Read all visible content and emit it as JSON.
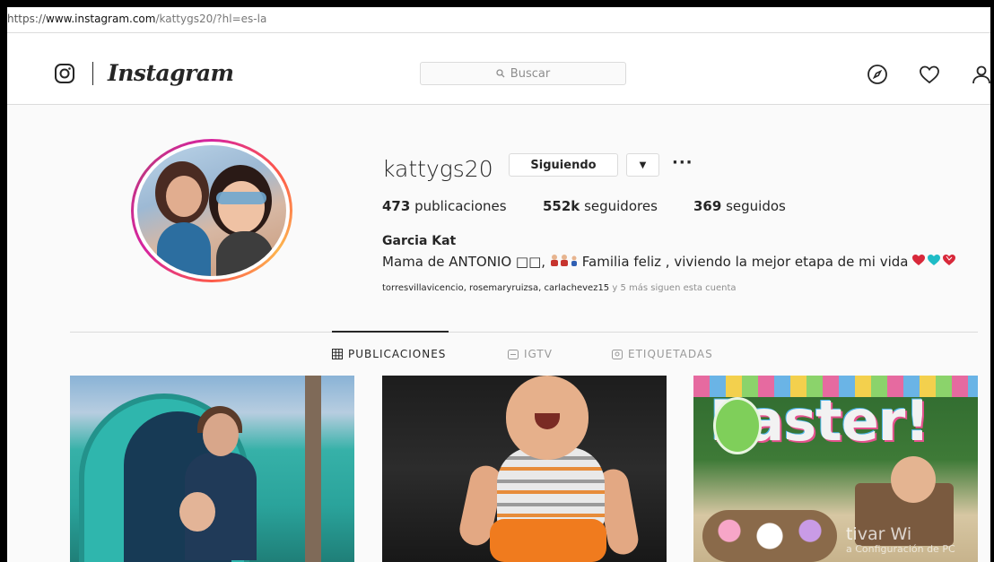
{
  "browser": {
    "url_prefix": "https://",
    "url_host": "www.instagram.com",
    "url_path": "/kattygs20/?hl=es-la"
  },
  "header": {
    "logo_text": "Instagram",
    "search_placeholder": "Buscar",
    "icons": [
      "camera-icon",
      "compass-icon",
      "heart-icon",
      "user-icon"
    ]
  },
  "profile": {
    "username": "kattygs20",
    "follow_label": "Siguiendo",
    "more_label": "···",
    "stats": {
      "posts_count": "473",
      "posts_label": " publicaciones",
      "followers_count": "552k",
      "followers_label": " seguidores",
      "following_count": "369",
      "following_label": " seguidos"
    },
    "full_name": "Garcia Kat",
    "bio_start": "Mama de ANTONIO □□,",
    "bio_end": "Familia feliz , viviendo la mejor etapa de mi vida",
    "followed_by_names": "torresvillavicencio, rosemaryruizsa, carlachevez15",
    "followed_by_suffix": " y 5 más siguen esta cuenta"
  },
  "tabs": [
    {
      "label": "PUBLICACIONES",
      "icon": "grid-icon",
      "active": true
    },
    {
      "label": "IGTV",
      "icon": "igtv-icon",
      "active": false
    },
    {
      "label": "ETIQUETADAS",
      "icon": "tag-icon",
      "active": false
    }
  ],
  "posts": {
    "post3_text": "Easter!"
  },
  "overlay": {
    "watermark_main": "tivar Wi",
    "watermark_sub": "a Configuración de PC"
  },
  "colors": {
    "accent_ring": "#d6249f",
    "heart_red": "#ed4956",
    "heart_teal": "#20c3c8"
  }
}
